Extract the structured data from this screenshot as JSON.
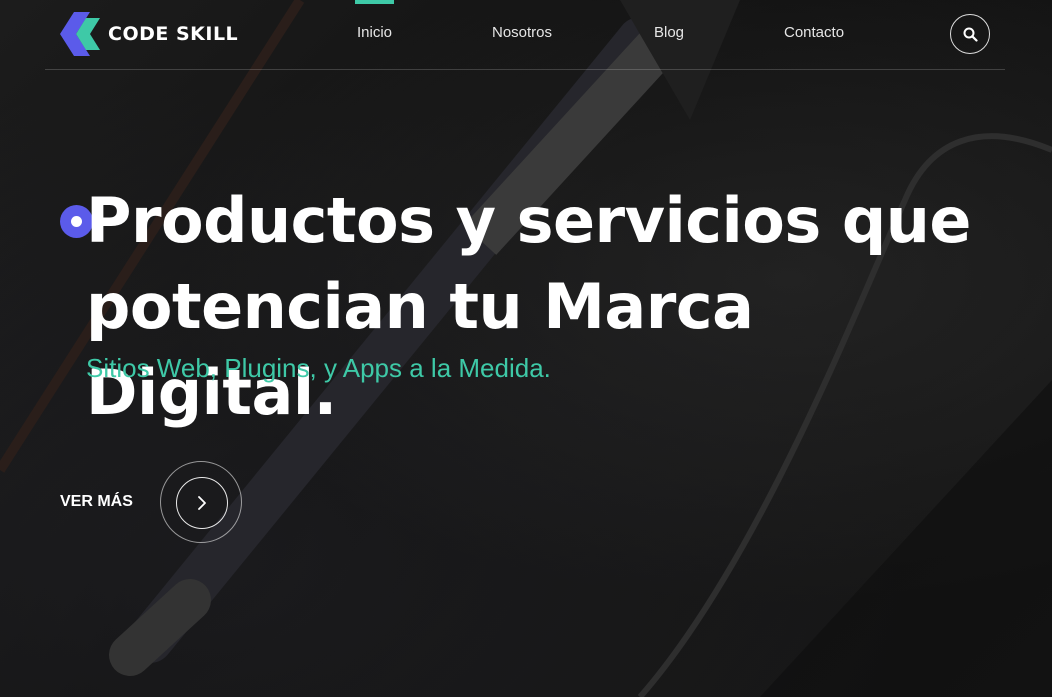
{
  "brand": {
    "name": "CODE SKILL",
    "accent": "#3ec9a7",
    "logo_purple": "#5b5bea"
  },
  "nav": {
    "items": [
      {
        "label": "Inicio",
        "active": true
      },
      {
        "label": "Nosotros",
        "active": false
      },
      {
        "label": "Blog",
        "active": false
      },
      {
        "label": "Contacto",
        "active": false
      }
    ],
    "search_icon": "search-icon"
  },
  "hero": {
    "headline": "Productos y servicios que potencian tu Marca Digital.",
    "subheadline": "Sitios Web, Plugins, y Apps a la Medida.",
    "cta_label": "VER MÁS",
    "cta_icon": "chevron-right-icon"
  }
}
